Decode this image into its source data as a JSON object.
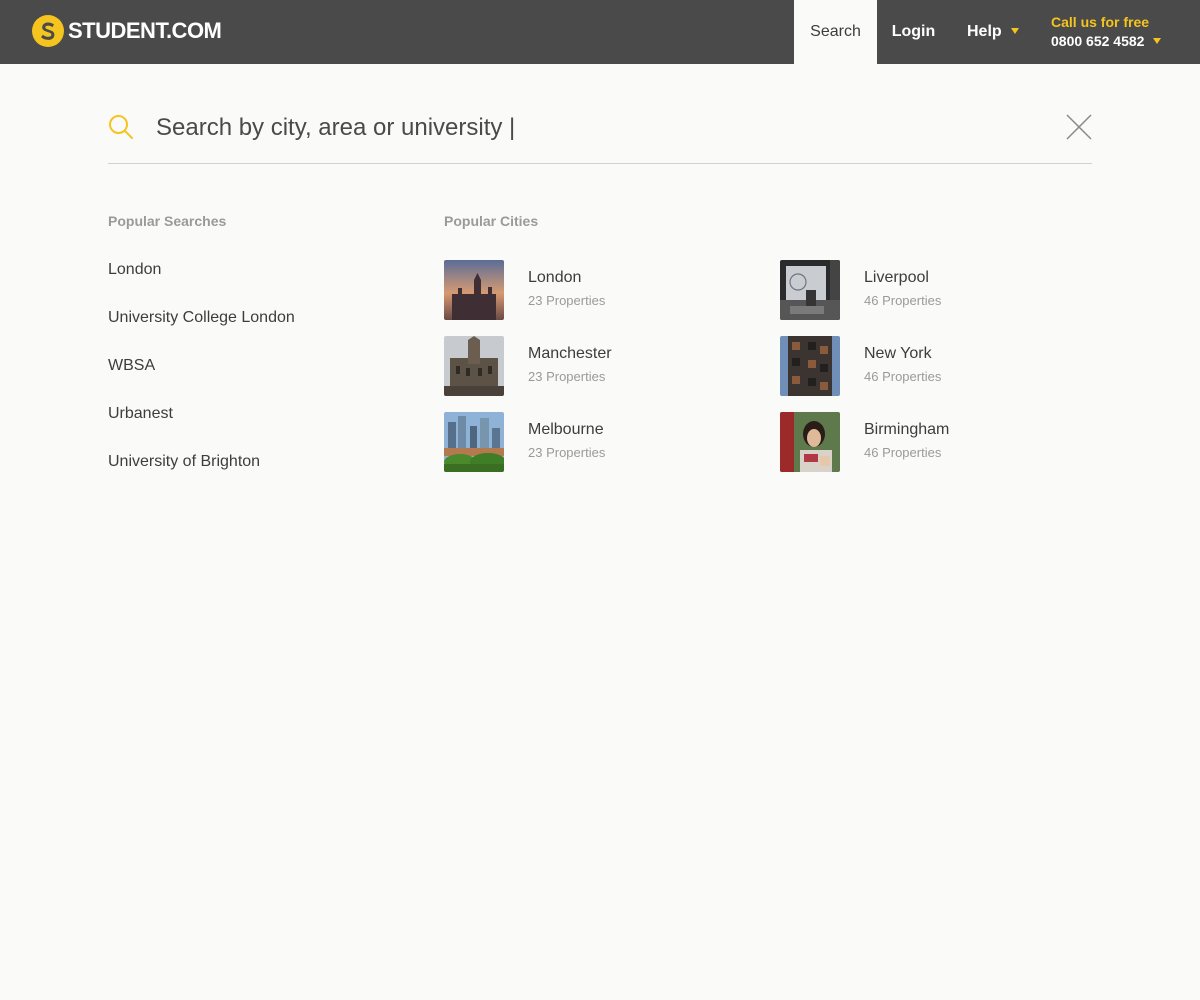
{
  "header": {
    "logo_text": "STUDENT.COM",
    "nav": {
      "search": "Search",
      "login": "Login",
      "help": "Help"
    },
    "call_label": "Call us for free",
    "call_number": "0800 652 4582"
  },
  "colors": {
    "brand_yellow": "#f5c41e",
    "header_bg": "#4a4a4a",
    "page_bg": "#fafaf8"
  },
  "search": {
    "placeholder": "Search by city, area or university |",
    "icon": "search-icon",
    "close_icon": "close-icon"
  },
  "popular_searches": {
    "title": "Popular Searches",
    "items": [
      "London",
      "University College London",
      "WBSA",
      "Urbanest",
      "University of Brighton"
    ]
  },
  "popular_cities": {
    "title": "Popular Cities",
    "items": [
      {
        "name": "London",
        "count": "23 Properties"
      },
      {
        "name": "Liverpool",
        "count": "46 Properties"
      },
      {
        "name": "Manchester",
        "count": "23 Properties"
      },
      {
        "name": "New York",
        "count": "46 Properties"
      },
      {
        "name": "Melbourne",
        "count": "23 Properties"
      },
      {
        "name": "Birmingham",
        "count": "46 Properties"
      }
    ]
  }
}
